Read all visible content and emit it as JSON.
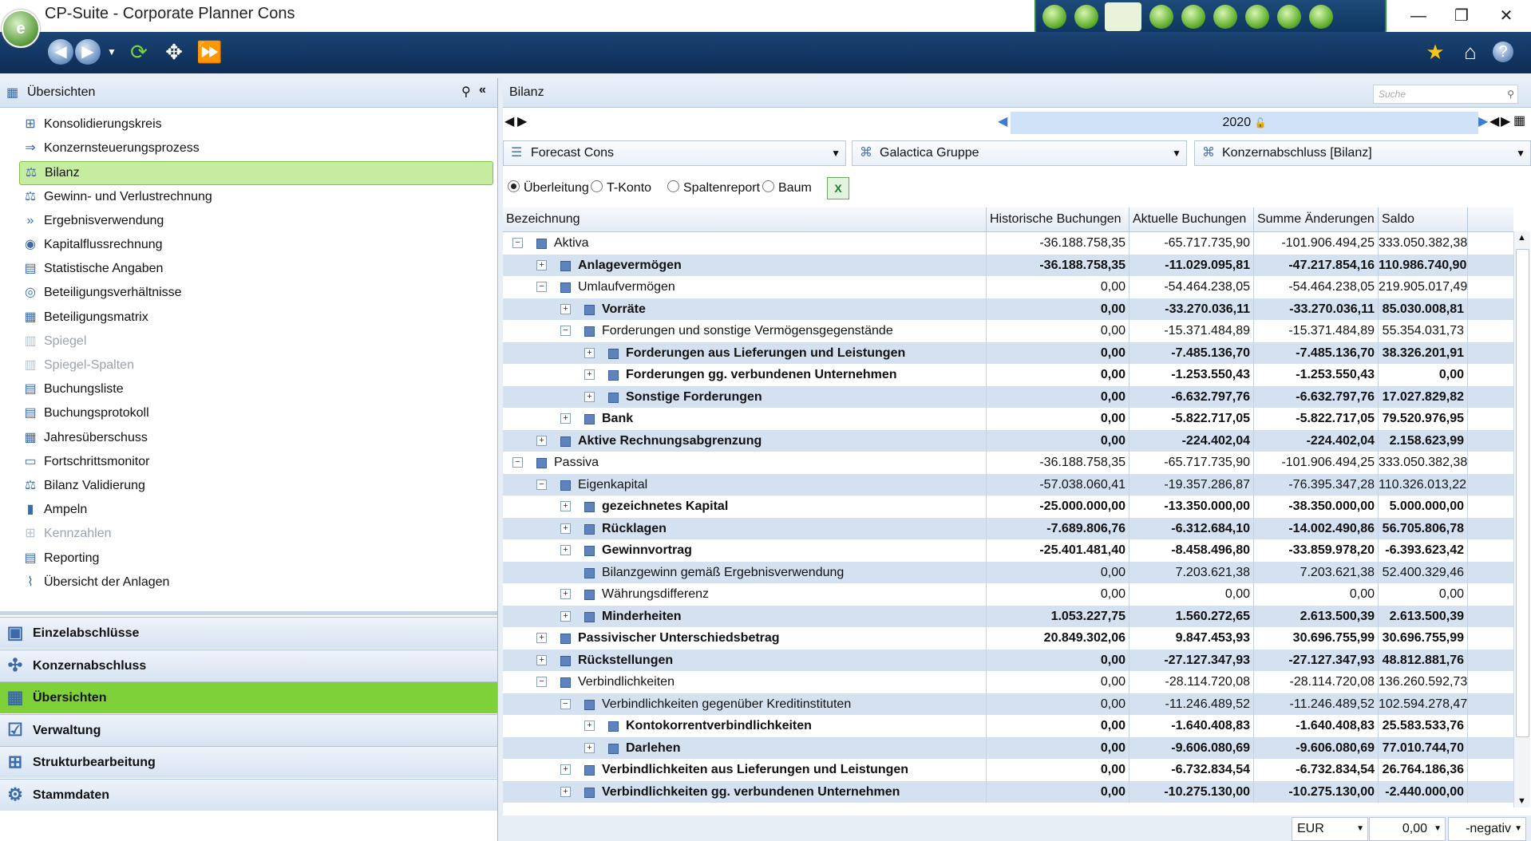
{
  "app": {
    "title": "CP-Suite - Corporate Planner Cons"
  },
  "left": {
    "header": "Übersichten",
    "items": [
      {
        "label": "Konsolidierungskreis",
        "icon": "tree-structure-icon",
        "disabled": false,
        "selected": false
      },
      {
        "label": "Konzernsteuerungsprozess",
        "icon": "process-icon",
        "disabled": false,
        "selected": false
      },
      {
        "label": "Bilanz",
        "icon": "scales-icon",
        "disabled": false,
        "selected": true
      },
      {
        "label": "Gewinn- und Verlustrechnung",
        "icon": "profit-loss-icon",
        "disabled": false,
        "selected": false
      },
      {
        "label": "Ergebnisverwendung",
        "icon": "forward-arrows-icon",
        "disabled": false,
        "selected": false
      },
      {
        "label": "Kapitalflussrechnung",
        "icon": "cashflow-icon",
        "disabled": false,
        "selected": false
      },
      {
        "label": "Statistische Angaben",
        "icon": "statistics-icon",
        "disabled": false,
        "selected": false
      },
      {
        "label": "Beteiligungsverhältnisse",
        "icon": "participations-icon",
        "disabled": false,
        "selected": false
      },
      {
        "label": "Beteiligungsmatrix",
        "icon": "matrix-icon",
        "disabled": false,
        "selected": false
      },
      {
        "label": "Spiegel",
        "icon": "mirror-icon",
        "disabled": true,
        "selected": false
      },
      {
        "label": "Spiegel-Spalten",
        "icon": "mirror-columns-icon",
        "disabled": true,
        "selected": false
      },
      {
        "label": "Buchungsliste",
        "icon": "booking-list-icon",
        "disabled": false,
        "selected": false
      },
      {
        "label": "Buchungsprotokoll",
        "icon": "booking-log-icon",
        "disabled": false,
        "selected": false
      },
      {
        "label": "Jahresüberschuss",
        "icon": "annual-surplus-icon",
        "disabled": false,
        "selected": false
      },
      {
        "label": "Fortschrittsmonitor",
        "icon": "progress-monitor-icon",
        "disabled": false,
        "selected": false
      },
      {
        "label": "Bilanz Validierung",
        "icon": "validation-icon",
        "disabled": false,
        "selected": false
      },
      {
        "label": "Ampeln",
        "icon": "traffic-light-icon",
        "disabled": false,
        "selected": false
      },
      {
        "label": "Kennzahlen",
        "icon": "kpi-icon",
        "disabled": true,
        "selected": false
      },
      {
        "label": "Reporting",
        "icon": "report-icon",
        "disabled": false,
        "selected": false
      },
      {
        "label": "Übersicht der Anlagen",
        "icon": "paperclip-icon",
        "disabled": false,
        "selected": false
      }
    ],
    "sections": [
      {
        "label": "Einzelabschlüsse",
        "active": false
      },
      {
        "label": "Konzernabschluss",
        "active": false
      },
      {
        "label": "Übersichten",
        "active": true
      },
      {
        "label": "Verwaltung",
        "active": false
      },
      {
        "label": "Strukturbearbeitung",
        "active": false
      },
      {
        "label": "Stammdaten",
        "active": false
      }
    ]
  },
  "right": {
    "title": "Bilanz",
    "search_placeholder": "Suche",
    "year": "2020",
    "dropdowns": {
      "scenario": "Forecast Cons",
      "company": "Galactica Gruppe",
      "report": "Konzernabschluss [Bilanz]"
    },
    "view_modes": [
      {
        "label": "Überleitung",
        "checked": true
      },
      {
        "label": "T-Konto",
        "checked": false
      },
      {
        "label": "Spaltenreport",
        "checked": false
      },
      {
        "label": "Baum",
        "checked": false
      }
    ],
    "columns": [
      "Bezeichnung",
      "Historische Buchungen",
      "Aktuelle Buchungen",
      "Summe Änderungen",
      "Saldo"
    ],
    "rows": [
      {
        "level": 0,
        "toggle": "-",
        "bold": false,
        "alt": false,
        "name": "Aktiva",
        "v": [
          "-36.188.758,35",
          "-65.717.735,90",
          "-101.906.494,25",
          "333.050.382,38"
        ]
      },
      {
        "level": 1,
        "toggle": "+",
        "bold": true,
        "alt": true,
        "name": "Anlagevermögen",
        "v": [
          "-36.188.758,35",
          "-11.029.095,81",
          "-47.217.854,16",
          "110.986.740,90"
        ]
      },
      {
        "level": 1,
        "toggle": "-",
        "bold": false,
        "alt": false,
        "name": "Umlaufvermögen",
        "v": [
          "0,00",
          "-54.464.238,05",
          "-54.464.238,05",
          "219.905.017,49"
        ]
      },
      {
        "level": 2,
        "toggle": "+",
        "bold": true,
        "alt": true,
        "name": "Vorräte",
        "v": [
          "0,00",
          "-33.270.036,11",
          "-33.270.036,11",
          "85.030.008,81"
        ]
      },
      {
        "level": 2,
        "toggle": "-",
        "bold": false,
        "alt": false,
        "name": "Forderungen und sonstige Vermögensgegenstände",
        "v": [
          "0,00",
          "-15.371.484,89",
          "-15.371.484,89",
          "55.354.031,73"
        ]
      },
      {
        "level": 3,
        "toggle": "+",
        "bold": true,
        "alt": true,
        "name": "Forderungen aus Lieferungen und Leistungen",
        "v": [
          "0,00",
          "-7.485.136,70",
          "-7.485.136,70",
          "38.326.201,91"
        ]
      },
      {
        "level": 3,
        "toggle": "+",
        "bold": true,
        "alt": false,
        "name": "Forderungen gg. verbundenen Unternehmen",
        "v": [
          "0,00",
          "-1.253.550,43",
          "-1.253.550,43",
          "0,00"
        ]
      },
      {
        "level": 3,
        "toggle": "+",
        "bold": true,
        "alt": true,
        "name": "Sonstige Forderungen",
        "v": [
          "0,00",
          "-6.632.797,76",
          "-6.632.797,76",
          "17.027.829,82"
        ]
      },
      {
        "level": 2,
        "toggle": "+",
        "bold": true,
        "alt": false,
        "name": "Bank",
        "v": [
          "0,00",
          "-5.822.717,05",
          "-5.822.717,05",
          "79.520.976,95"
        ]
      },
      {
        "level": 1,
        "toggle": "+",
        "bold": true,
        "alt": true,
        "name": "Aktive Rechnungsabgrenzung",
        "v": [
          "0,00",
          "-224.402,04",
          "-224.402,04",
          "2.158.623,99"
        ]
      },
      {
        "level": 0,
        "toggle": "-",
        "bold": false,
        "alt": false,
        "name": "Passiva",
        "v": [
          "-36.188.758,35",
          "-65.717.735,90",
          "-101.906.494,25",
          "333.050.382,38"
        ]
      },
      {
        "level": 1,
        "toggle": "-",
        "bold": false,
        "alt": true,
        "name": "Eigenkapital",
        "v": [
          "-57.038.060,41",
          "-19.357.286,87",
          "-76.395.347,28",
          "110.326.013,22"
        ]
      },
      {
        "level": 2,
        "toggle": "+",
        "bold": true,
        "alt": false,
        "name": "gezeichnetes Kapital",
        "v": [
          "-25.000.000,00",
          "-13.350.000,00",
          "-38.350.000,00",
          "5.000.000,00"
        ]
      },
      {
        "level": 2,
        "toggle": "+",
        "bold": true,
        "alt": true,
        "name": "Rücklagen",
        "v": [
          "-7.689.806,76",
          "-6.312.684,10",
          "-14.002.490,86",
          "56.705.806,78"
        ]
      },
      {
        "level": 2,
        "toggle": "+",
        "bold": true,
        "alt": false,
        "name": "Gewinnvortrag",
        "v": [
          "-25.401.481,40",
          "-8.458.496,80",
          "-33.859.978,20",
          "-6.393.623,42"
        ]
      },
      {
        "level": 2,
        "toggle": "",
        "bold": false,
        "alt": true,
        "name": "Bilanzgewinn gemäß Ergebnisverwendung",
        "v": [
          "0,00",
          "7.203.621,38",
          "7.203.621,38",
          "52.400.329,46"
        ]
      },
      {
        "level": 2,
        "toggle": "+",
        "bold": false,
        "alt": false,
        "name": "Währungsdifferenz",
        "v": [
          "0,00",
          "0,00",
          "0,00",
          "0,00"
        ]
      },
      {
        "level": 2,
        "toggle": "+",
        "bold": true,
        "alt": true,
        "name": "Minderheiten",
        "v": [
          "1.053.227,75",
          "1.560.272,65",
          "2.613.500,39",
          "2.613.500,39"
        ]
      },
      {
        "level": 1,
        "toggle": "+",
        "bold": true,
        "alt": false,
        "name": "Passivischer Unterschiedsbetrag",
        "v": [
          "20.849.302,06",
          "9.847.453,93",
          "30.696.755,99",
          "30.696.755,99"
        ]
      },
      {
        "level": 1,
        "toggle": "+",
        "bold": true,
        "alt": true,
        "name": "Rückstellungen",
        "v": [
          "0,00",
          "-27.127.347,93",
          "-27.127.347,93",
          "48.812.881,76"
        ]
      },
      {
        "level": 1,
        "toggle": "-",
        "bold": false,
        "alt": false,
        "name": "Verbindlichkeiten",
        "v": [
          "0,00",
          "-28.114.720,08",
          "-28.114.720,08",
          "136.260.592,73"
        ]
      },
      {
        "level": 2,
        "toggle": "-",
        "bold": false,
        "alt": true,
        "name": "Verbindlichkeiten gegenüber Kreditinstituten",
        "v": [
          "0,00",
          "-11.246.489,52",
          "-11.246.489,52",
          "102.594.278,47"
        ]
      },
      {
        "level": 3,
        "toggle": "+",
        "bold": true,
        "alt": false,
        "name": "Kontokorrentverbindlichkeiten",
        "v": [
          "0,00",
          "-1.640.408,83",
          "-1.640.408,83",
          "25.583.533,76"
        ]
      },
      {
        "level": 3,
        "toggle": "+",
        "bold": true,
        "alt": true,
        "name": "Darlehen",
        "v": [
          "0,00",
          "-9.606.080,69",
          "-9.606.080,69",
          "77.010.744,70"
        ]
      },
      {
        "level": 2,
        "toggle": "+",
        "bold": true,
        "alt": false,
        "name": "Verbindlichkeiten aus Lieferungen und Leistungen",
        "v": [
          "0,00",
          "-6.732.834,54",
          "-6.732.834,54",
          "26.764.186,36"
        ]
      },
      {
        "level": 2,
        "toggle": "+",
        "bold": true,
        "alt": true,
        "name": "Verbindlichkeiten gg. verbundenen Unternehmen",
        "v": [
          "0,00",
          "-10.275.130,00",
          "-10.275.130,00",
          "-2.440.000,00"
        ]
      }
    ],
    "footer": {
      "currency": "EUR",
      "number_format": "0,00",
      "negative_format": "-negativ"
    }
  }
}
